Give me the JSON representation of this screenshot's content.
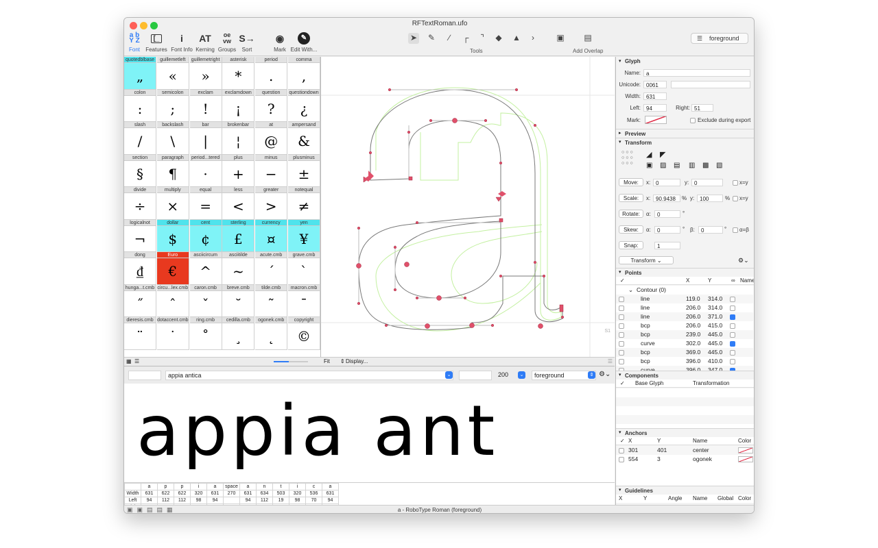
{
  "window": {
    "title": "RFTextRoman.ufo"
  },
  "toolbar": {
    "buttons": [
      {
        "label": "Font",
        "icon": "font-icon"
      },
      {
        "label": "Features",
        "icon": "features-icon"
      },
      {
        "label": "Font Info",
        "icon": "font-info-icon"
      },
      {
        "label": "Kerning",
        "icon": "kerning-icon"
      },
      {
        "label": "Groups",
        "icon": "groups-icon"
      },
      {
        "label": "Sort",
        "icon": "sort-icon"
      },
      {
        "label": "Mark",
        "icon": "mark-icon"
      },
      {
        "label": "Edit With...",
        "icon": "edit-with-icon"
      }
    ],
    "tools_label": "Tools",
    "add_overlap_label": "Add Overlap",
    "layer": "foreground"
  },
  "glyph_grid": {
    "cells": [
      [
        "quotedblbase",
        "„"
      ],
      [
        "guillemetleft",
        "«"
      ],
      [
        "guillemetright",
        "»"
      ],
      [
        "asterisk",
        "*"
      ],
      [
        "period",
        "."
      ],
      [
        "comma",
        ","
      ],
      [
        "colon",
        ":"
      ],
      [
        "semicolon",
        ";"
      ],
      [
        "exclam",
        "!"
      ],
      [
        "exclamdown",
        "¡"
      ],
      [
        "question",
        "?"
      ],
      [
        "questiondown",
        "¿"
      ],
      [
        "slash",
        "/"
      ],
      [
        "backslash",
        "\\"
      ],
      [
        "bar",
        "|"
      ],
      [
        "brokenbar",
        "¦"
      ],
      [
        "at",
        "@"
      ],
      [
        "ampersand",
        "&"
      ],
      [
        "section",
        "§"
      ],
      [
        "paragraph",
        "¶"
      ],
      [
        "period...tered",
        "·"
      ],
      [
        "plus",
        "+"
      ],
      [
        "minus",
        "−"
      ],
      [
        "plusminus",
        "±"
      ],
      [
        "divide",
        "÷"
      ],
      [
        "multiply",
        "×"
      ],
      [
        "equal",
        "="
      ],
      [
        "less",
        "<"
      ],
      [
        "greater",
        ">"
      ],
      [
        "notequal",
        "≠"
      ],
      [
        "logicalnot",
        "¬"
      ],
      [
        "dollar",
        "$"
      ],
      [
        "cent",
        "¢"
      ],
      [
        "sterling",
        "£"
      ],
      [
        "currency",
        "¤"
      ],
      [
        "yen",
        "¥"
      ],
      [
        "dong",
        "₫"
      ],
      [
        "Euro",
        "€"
      ],
      [
        "asciicircum",
        "^"
      ],
      [
        "asciitilde",
        "~"
      ],
      [
        "acute.cmb",
        "ˊ"
      ],
      [
        "grave.cmb",
        "ˋ"
      ],
      [
        "hunga...t.cmb",
        "˝"
      ],
      [
        "circu...lex.cmb",
        "ˆ"
      ],
      [
        "caron.cmb",
        "ˇ"
      ],
      [
        "breve.cmb",
        "˘"
      ],
      [
        "tilde.cmb",
        "˜"
      ],
      [
        "macron.cmb",
        "¯"
      ],
      [
        "dieresis.cmb",
        "¨"
      ],
      [
        "dotaccent.cmb",
        "˙"
      ],
      [
        "ring.cmb",
        "˚"
      ],
      [
        "cedilla.cmb",
        "¸"
      ],
      [
        "ogonek.cmb",
        "˛"
      ],
      [
        "copyright",
        "©"
      ]
    ]
  },
  "canvas": {
    "zoom": "Fit",
    "display": "Display...",
    "glyph": "a"
  },
  "inspector": {
    "glyph_section": "Glyph",
    "name_label": "Name:",
    "name": "a",
    "unicode_label": "Unicode:",
    "unicode": "0061",
    "width_label": "Width:",
    "width": "631",
    "left_label": "Left:",
    "left": "94",
    "right_label": "Right:",
    "right": "51",
    "mark_label": "Mark:",
    "exclude_label": "Exclude during export",
    "preview_section": "Preview",
    "transform_section": "Transform",
    "move_label": "Move:",
    "move_x": "0",
    "move_y": "0",
    "scale_label": "Scale:",
    "scale_x": "90.9438",
    "scale_y": "100",
    "rotate_label": "Rotate:",
    "rotate": "0",
    "skew_label": "Skew:",
    "skew_a": "0",
    "skew_b": "0",
    "snap_label": "Snap:",
    "snap": "1",
    "transform_menu": "Transform",
    "x_label": "x:",
    "y_label": "y:",
    "pct": "%",
    "alpha_label": "α:",
    "beta_label": "β:",
    "deg": "°",
    "xy_label": "x=y",
    "ab_label": "α=β",
    "points_section": "Points",
    "points_cols": [
      "X",
      "Y",
      "∞",
      "Name"
    ],
    "contour": "Contour (0)",
    "points": [
      {
        "type": "line",
        "x": "119.0",
        "y": "314.0",
        "smooth": false
      },
      {
        "type": "line",
        "x": "206.0",
        "y": "314.0",
        "smooth": false
      },
      {
        "type": "line",
        "x": "206.0",
        "y": "371.0",
        "smooth": true
      },
      {
        "type": "bcp",
        "x": "206.0",
        "y": "415.0",
        "smooth": false
      },
      {
        "type": "bcp",
        "x": "239.0",
        "y": "445.0",
        "smooth": false
      },
      {
        "type": "curve",
        "x": "302.0",
        "y": "445.0",
        "smooth": true
      },
      {
        "type": "bcp",
        "x": "369.0",
        "y": "445.0",
        "smooth": false
      },
      {
        "type": "bcp",
        "x": "396.0",
        "y": "410.0",
        "smooth": false
      },
      {
        "type": "curve",
        "x": "396.0",
        "y": "347.0",
        "smooth": true
      }
    ],
    "components_section": "Components",
    "components_cols": [
      "Base Glyph",
      "Transformation"
    ],
    "anchors_section": "Anchors",
    "anchors_cols": [
      "X",
      "Y",
      "Name",
      "Color"
    ],
    "anchors": [
      {
        "x": "301",
        "y": "401",
        "name": "center"
      },
      {
        "x": "554",
        "y": "3",
        "name": "ogonek"
      }
    ],
    "guidelines_section": "Guidelines",
    "guidelines_cols": [
      "X",
      "Y",
      "Angle",
      "Name",
      "Global",
      "Color"
    ]
  },
  "space_center": {
    "text": "appia antica",
    "size": "200",
    "layer": "foreground",
    "preview": "appia ant",
    "metrics": {
      "glyphs": [
        "a",
        "p",
        "p",
        "i",
        "a",
        "space",
        "a",
        "n",
        "t",
        "i",
        "c",
        "a"
      ],
      "width": [
        "631",
        "622",
        "622",
        "320",
        "631",
        "270",
        "631",
        "634",
        "503",
        "320",
        "536",
        "631"
      ],
      "left": [
        "94",
        "112",
        "112",
        "98",
        "94",
        "",
        "94",
        "112",
        "19",
        "98",
        "70",
        "94"
      ],
      "right": [
        "51",
        "70",
        "70",
        "98",
        "51",
        "",
        "51",
        "112",
        "56",
        "98",
        "70",
        "51"
      ],
      "row_labels": [
        "Width",
        "Left",
        "Right"
      ]
    }
  },
  "status": "a - RoboType Roman (foreground)",
  "colors": {
    "selection": "#7ff3f7",
    "mark_red": "#e8391f",
    "accent": "#2f7cf6",
    "point": "#e0506a"
  }
}
